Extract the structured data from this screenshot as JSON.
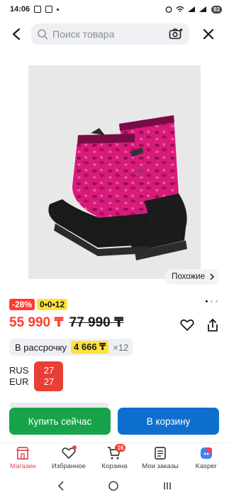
{
  "status": {
    "time": "14:06",
    "battery": "83"
  },
  "search": {
    "placeholder": "Поиск товара"
  },
  "gallery": {
    "similar_label": "Похожие"
  },
  "badges": {
    "sale": "-28%",
    "installment": "0•0•12"
  },
  "price": {
    "current": "55 990 ₸",
    "old": "77 990 ₸"
  },
  "installment": {
    "label": "В рассрочку",
    "amount": "4 666 ₸",
    "times": "×12"
  },
  "currency": {
    "label_1": "RUS",
    "label_2": "EUR",
    "value_1": "27",
    "value_2": "27"
  },
  "actions": {
    "buy_now": "Купить сейчас",
    "add_to_cart": "В корзину"
  },
  "nav": {
    "items": [
      {
        "label": "Магазин",
        "icon": "shop-icon"
      },
      {
        "label": "Избранное",
        "icon": "heart-icon"
      },
      {
        "label": "Корзина",
        "icon": "cart-icon",
        "badge": "16"
      },
      {
        "label": "Мои заказы",
        "icon": "orders-icon"
      },
      {
        "label": "Kasper",
        "icon": "kasper-icon"
      }
    ]
  },
  "colors": {
    "accent_red": "#ff3b30",
    "buy_green": "#16a34a",
    "cart_blue": "#0f6fcf",
    "installment_yellow": "#ffe23b",
    "product_pink": "#d81b7a"
  }
}
